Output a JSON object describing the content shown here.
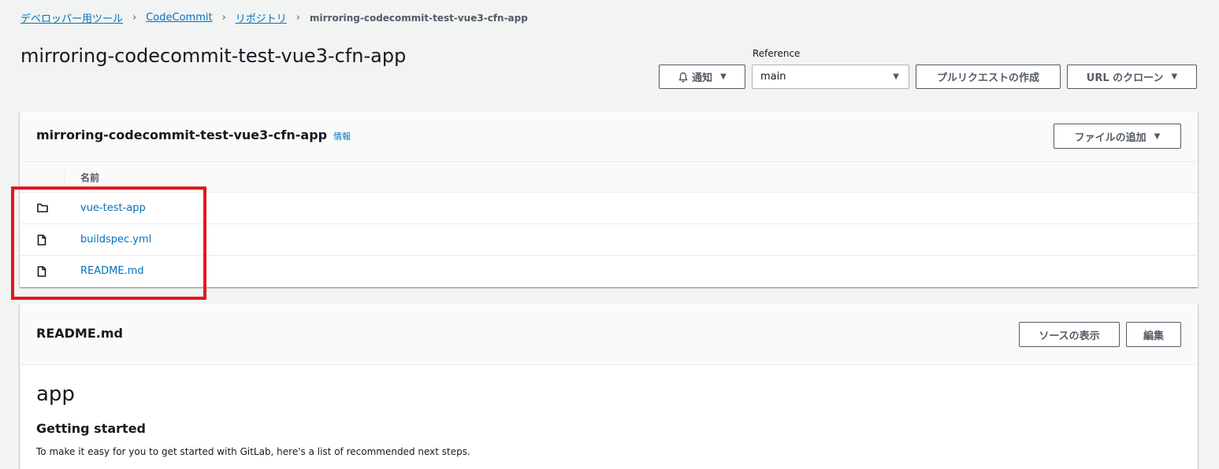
{
  "breadcrumb": {
    "items": [
      "デベロッパー用ツール",
      "CodeCommit",
      "リポジトリ"
    ],
    "current": "mirroring-codecommit-test-vue3-cfn-app"
  },
  "page_title": "mirroring-codecommit-test-vue3-cfn-app",
  "header_actions": {
    "notify_label": "通知",
    "reference_label": "Reference",
    "reference_value": "main",
    "pull_request_label": "プルリクエストの作成",
    "clone_url_label": "URL のクローン"
  },
  "repo_panel": {
    "title": "mirroring-codecommit-test-vue3-cfn-app",
    "info_label": "情報",
    "add_file_label": "ファイルの追加",
    "column_name": "名前",
    "files": [
      {
        "name": "vue-test-app",
        "icon": "folder-icon"
      },
      {
        "name": "buildspec.yml",
        "icon": "file-icon"
      },
      {
        "name": "README.md",
        "icon": "file-icon"
      }
    ]
  },
  "readme_panel": {
    "title": "README.md",
    "view_source_label": "ソースの表示",
    "edit_label": "編集",
    "h1": "app",
    "h2": "Getting started",
    "paragraph": "To make it easy for you to get started with GitLab, here's a list of recommended next steps."
  },
  "colors": {
    "link": "#0073bb",
    "highlight": "#e3191e",
    "background": "#f2f3f3"
  }
}
